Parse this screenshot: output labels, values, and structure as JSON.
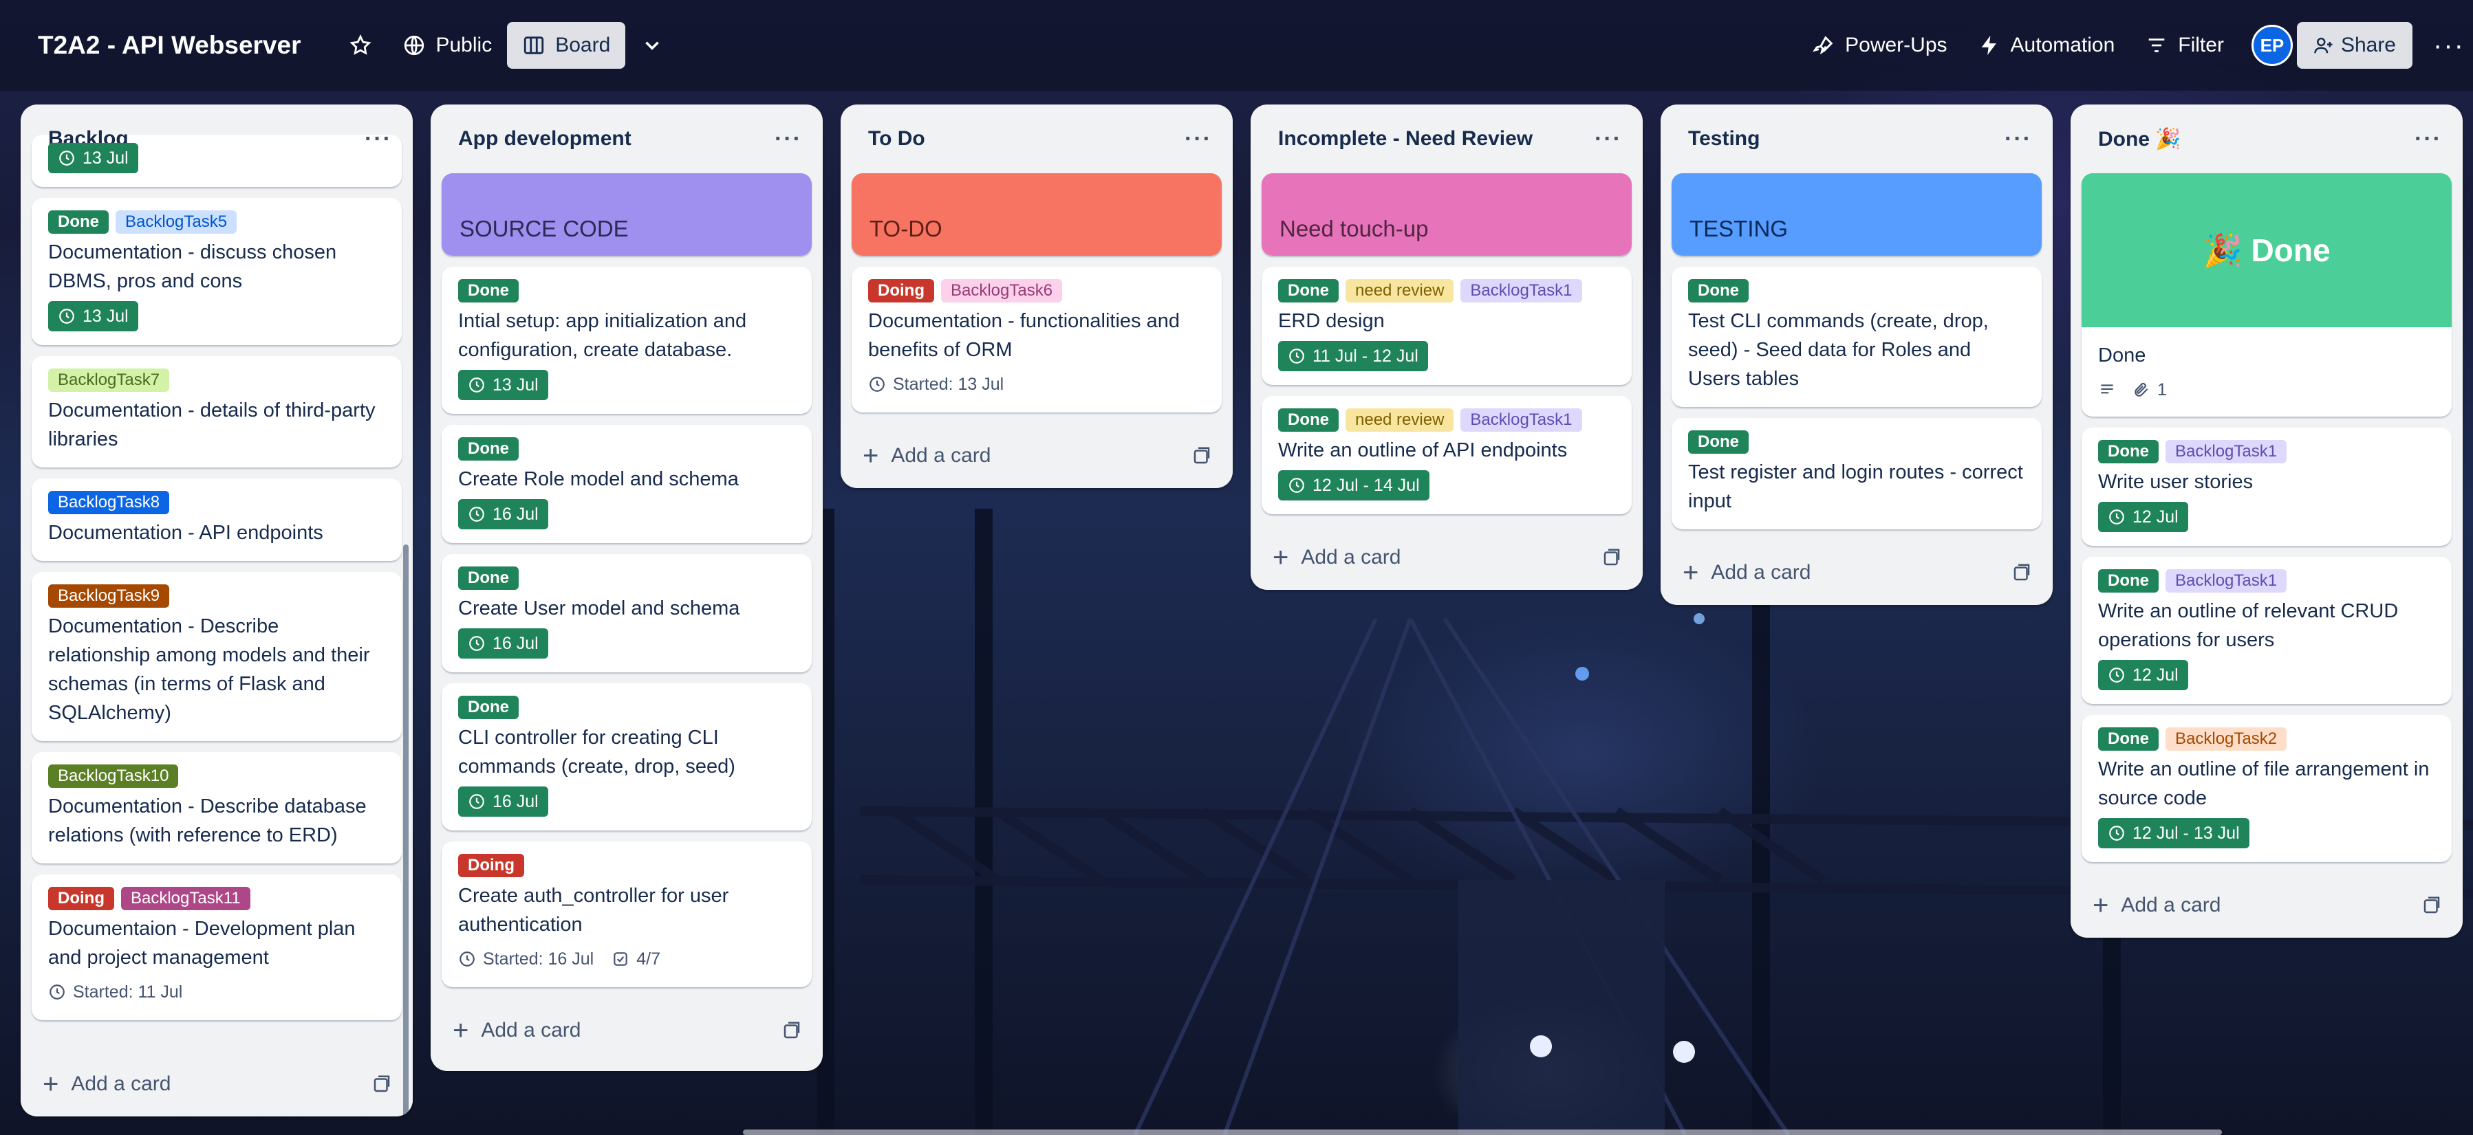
{
  "header": {
    "board_title": "T2A2 - API Webserver",
    "visibility": "Public",
    "view": "Board",
    "power_ups": "Power-Ups",
    "automation": "Automation",
    "filter": "Filter",
    "avatar": "EP",
    "share": "Share"
  },
  "add_card_label": "Add a card",
  "lists": {
    "backlog": {
      "title": "Backlog",
      "cards": [
        {
          "date": "13 Jul"
        },
        {
          "labels": [
            "Done",
            "BacklogTask5"
          ],
          "title": "Documentation - discuss chosen DBMS, pros and cons",
          "date": "13 Jul"
        },
        {
          "labels": [
            "BacklogTask7"
          ],
          "title": "Documentation - details of third-party libraries"
        },
        {
          "labels": [
            "BacklogTask8"
          ],
          "title": "Documentation - API endpoints"
        },
        {
          "labels": [
            "BacklogTask9"
          ],
          "title": "Documentation - Describe relationship among models and their schemas (in terms of Flask and SQLAlchemy)"
        },
        {
          "labels": [
            "BacklogTask10"
          ],
          "title": "Documentation - Describe database relations (with reference to ERD)"
        },
        {
          "labels": [
            "Doing",
            "BacklogTask11"
          ],
          "title": "Documentaion - Development plan and project management",
          "started": "Started: 11 Jul"
        }
      ]
    },
    "appdev": {
      "title": "App development",
      "cover": "SOURCE CODE",
      "cards": [
        {
          "labels": [
            "Done"
          ],
          "title": "Intial setup: app initialization and configuration, create database.",
          "date": "13 Jul"
        },
        {
          "labels": [
            "Done"
          ],
          "title": "Create Role model and schema",
          "date": "16 Jul"
        },
        {
          "labels": [
            "Done"
          ],
          "title": "Create User model and schema",
          "date": "16 Jul"
        },
        {
          "labels": [
            "Done"
          ],
          "title": "CLI controller for creating CLI commands (create, drop, seed)",
          "date": "16 Jul"
        },
        {
          "labels": [
            "Doing"
          ],
          "title": "Create auth_controller for user authentication",
          "started": "Started: 16 Jul",
          "checklist": "4/7"
        }
      ]
    },
    "todo": {
      "title": "To Do",
      "cover": "TO-DO",
      "cards": [
        {
          "labels": [
            "Doing",
            "BacklogTask6"
          ],
          "title": "Documentation - functionalities and benefits of ORM",
          "started": "Started: 13 Jul"
        }
      ]
    },
    "review": {
      "title": "Incomplete - Need Review",
      "cover": "Need touch-up",
      "cards": [
        {
          "labels": [
            "Done",
            "need review",
            "BacklogTask1"
          ],
          "title": "ERD design",
          "date": "11 Jul - 12 Jul"
        },
        {
          "labels": [
            "Done",
            "need review",
            "BacklogTask1"
          ],
          "title": "Write an outline of API endpoints",
          "date": "12 Jul - 14 Jul"
        }
      ]
    },
    "testing": {
      "title": "Testing",
      "cover": "TESTING",
      "cards": [
        {
          "labels": [
            "Done"
          ],
          "title": "Test CLI commands (create, drop, seed) - Seed data for Roles and Users tables"
        },
        {
          "labels": [
            "Done"
          ],
          "title": "Test register and login routes - correct input"
        }
      ]
    },
    "done": {
      "title": "Done 🎉",
      "cover": "🎉 Done",
      "cover_card": {
        "title": "Done",
        "attachments": "1"
      },
      "cards": [
        {
          "labels": [
            "Done",
            "BacklogTask1"
          ],
          "title": "Write user stories",
          "date": "12 Jul"
        },
        {
          "labels": [
            "Done",
            "BacklogTask1"
          ],
          "title": "Write an outline of relevant CRUD operations for users",
          "date": "12 Jul"
        },
        {
          "labels": [
            "Done",
            "BacklogTask2"
          ],
          "title": "Write an outline of file arrangement in source code",
          "date": "12 Jul - 13 Jul"
        }
      ]
    }
  },
  "colors": {
    "done_label": "#1f845a",
    "doing_label": "#c9372c",
    "cover_appdev": "#9f8fef",
    "cover_todo": "#f87462",
    "cover_review": "#e774bb",
    "cover_testing": "#579dff",
    "cover_done": "#4bce97"
  }
}
